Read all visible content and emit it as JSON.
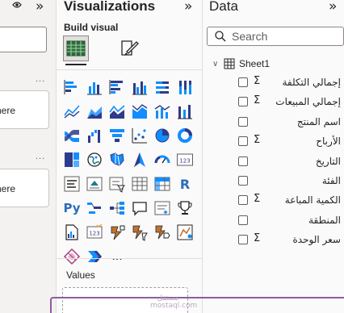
{
  "filters": {
    "drop_text_1": "here",
    "drop_text_2": "here",
    "more": "..."
  },
  "visualizations": {
    "title": "Visualizations",
    "collapse_icon": "chevron-double-right",
    "build_visual": "Build visual",
    "values_label": "Values",
    "more_visuals": "...",
    "r_glyph": "R",
    "py_glyph": "Py",
    "card_glyph": "123"
  },
  "data": {
    "title": "Data",
    "collapse_icon": "chevron-double-right",
    "search_placeholder": "Search",
    "table_name": "Sheet1",
    "fields": [
      {
        "label": "إجمالي التكلفة",
        "numeric": true
      },
      {
        "label": "إجمالي المبيعات",
        "numeric": true
      },
      {
        "label": "اسم المنتج",
        "numeric": false
      },
      {
        "label": "الأرباح",
        "numeric": true
      },
      {
        "label": "التاريخ",
        "numeric": false
      },
      {
        "label": "الفئة",
        "numeric": false
      },
      {
        "label": "الكمية المباعة",
        "numeric": true
      },
      {
        "label": "المنطقة",
        "numeric": false
      },
      {
        "label": "سعر الوحدة",
        "numeric": true
      }
    ]
  },
  "watermark": {
    "line1": "مستقل",
    "line2": "mostaql.com"
  },
  "colors": {
    "accent_blue": "#118dff",
    "accent_dark": "#2e3b8a",
    "accent_teal": "#1f7a8c",
    "frame_purple": "#8e5c9e"
  }
}
